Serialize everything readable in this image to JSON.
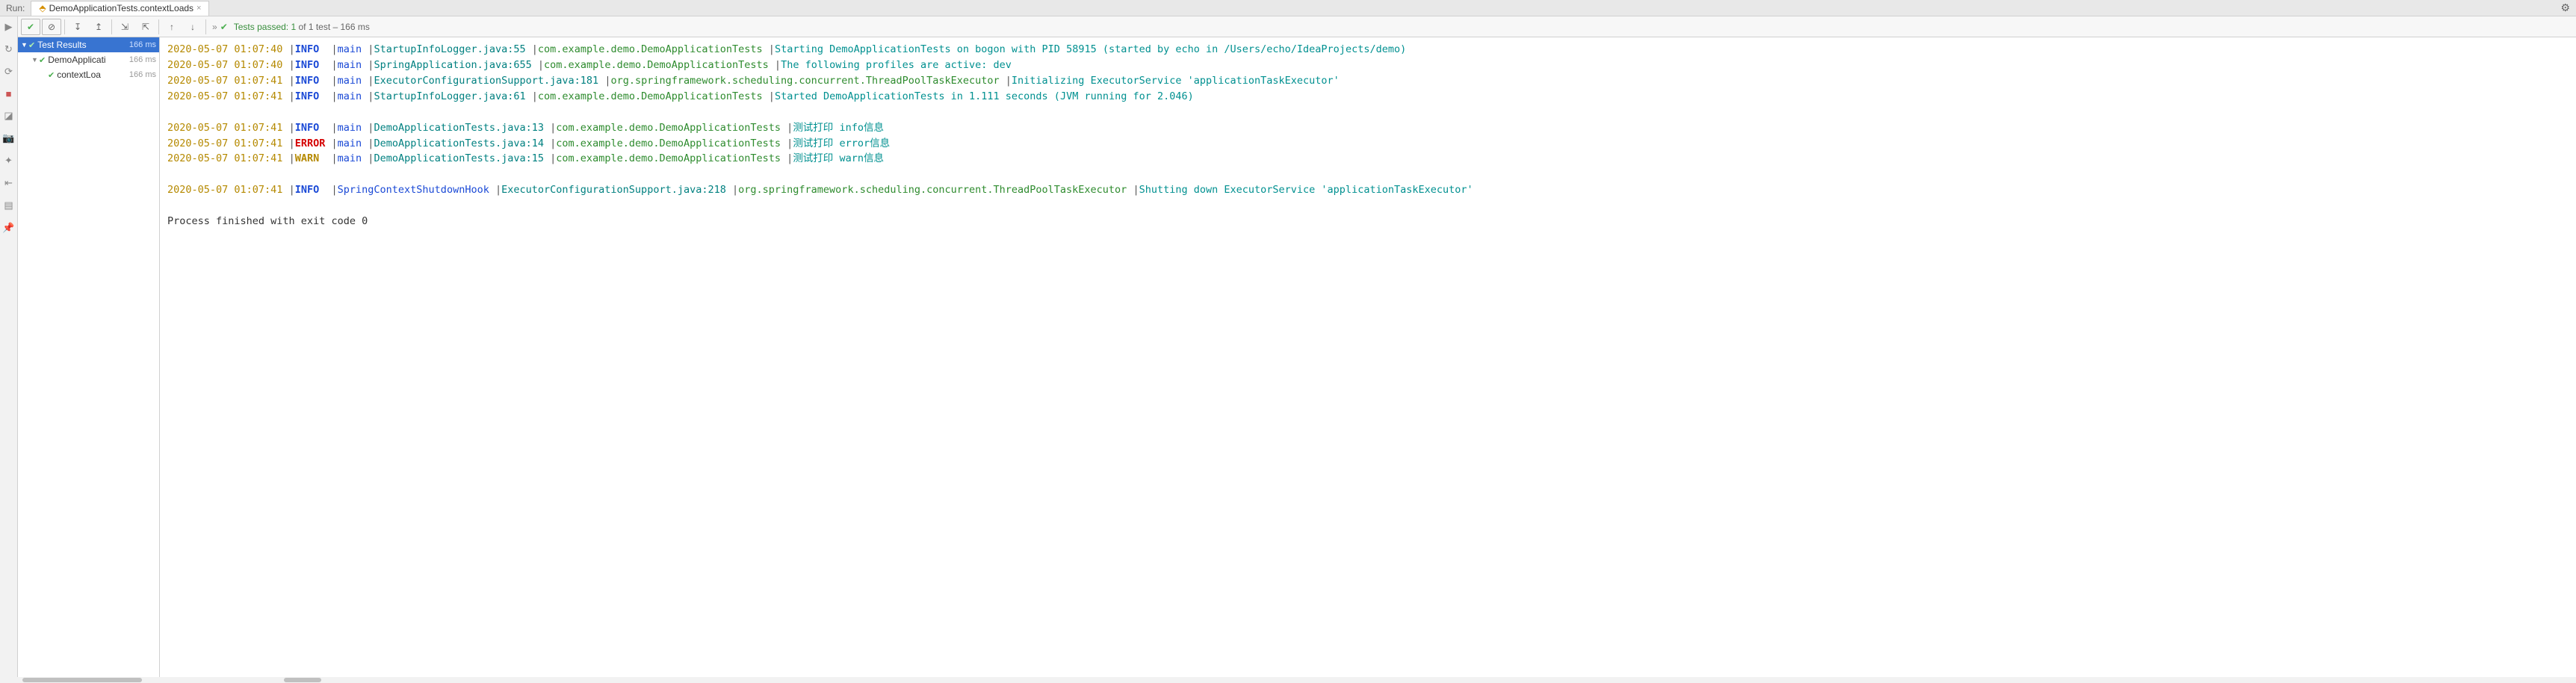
{
  "topbar": {
    "run_label": "Run:",
    "tab_title": "DemoApplicationTests.contextLoads"
  },
  "toolbar": {
    "status_prefix": "Tests passed: 1",
    "status_suffix": " of 1 test – 166 ms"
  },
  "tree": {
    "root": {
      "label": "Test Results",
      "duration": "166 ms"
    },
    "child": {
      "label": "DemoApplicati",
      "duration": "166 ms"
    },
    "leaf": {
      "label": "contextLoa",
      "duration": "166 ms"
    }
  },
  "log": [
    {
      "kind": "log",
      "ts": "2020-05-07 01:07:40",
      "level": "INFO",
      "thread": "main",
      "src": "StartupInfoLogger.java:55",
      "cls": "com.example.demo.DemoApplicationTests",
      "msg": "Starting DemoApplicationTests on bogon with PID 58915 (started by echo in /Users/echo/IdeaProjects/demo)"
    },
    {
      "kind": "log",
      "ts": "2020-05-07 01:07:40",
      "level": "INFO",
      "thread": "main",
      "src": "SpringApplication.java:655",
      "cls": "com.example.demo.DemoApplicationTests",
      "msg": "The following profiles are active: dev"
    },
    {
      "kind": "log",
      "ts": "2020-05-07 01:07:41",
      "level": "INFO",
      "thread": "main",
      "src": "ExecutorConfigurationSupport.java:181",
      "cls": "org.springframework.scheduling.concurrent.ThreadPoolTaskExecutor",
      "msg": "Initializing ExecutorService 'applicationTaskExecutor'"
    },
    {
      "kind": "log",
      "ts": "2020-05-07 01:07:41",
      "level": "INFO",
      "thread": "main",
      "src": "StartupInfoLogger.java:61",
      "cls": "com.example.demo.DemoApplicationTests",
      "msg": "Started DemoApplicationTests in 1.111 seconds (JVM running for 2.046)"
    },
    {
      "kind": "blank"
    },
    {
      "kind": "log",
      "ts": "2020-05-07 01:07:41",
      "level": "INFO",
      "thread": "main",
      "src": "DemoApplicationTests.java:13",
      "cls": "com.example.demo.DemoApplicationTests",
      "msg": "测试打印 info信息"
    },
    {
      "kind": "log",
      "ts": "2020-05-07 01:07:41",
      "level": "ERROR",
      "thread": "main",
      "src": "DemoApplicationTests.java:14",
      "cls": "com.example.demo.DemoApplicationTests",
      "msg": "测试打印 error信息"
    },
    {
      "kind": "log",
      "ts": "2020-05-07 01:07:41",
      "level": "WARN",
      "thread": "main",
      "src": "DemoApplicationTests.java:15",
      "cls": "com.example.demo.DemoApplicationTests",
      "msg": "测试打印 warn信息"
    },
    {
      "kind": "blank"
    },
    {
      "kind": "log",
      "ts": "2020-05-07 01:07:41",
      "level": "INFO",
      "thread": "SpringContextShutdownHook",
      "src": "ExecutorConfigurationSupport.java:218",
      "cls": "org.springframework.scheduling.concurrent.ThreadPoolTaskExecutor",
      "msg": "Shutting down ExecutorService 'applicationTaskExecutor'"
    },
    {
      "kind": "blank"
    },
    {
      "kind": "plain",
      "text": "Process finished with exit code 0"
    }
  ]
}
